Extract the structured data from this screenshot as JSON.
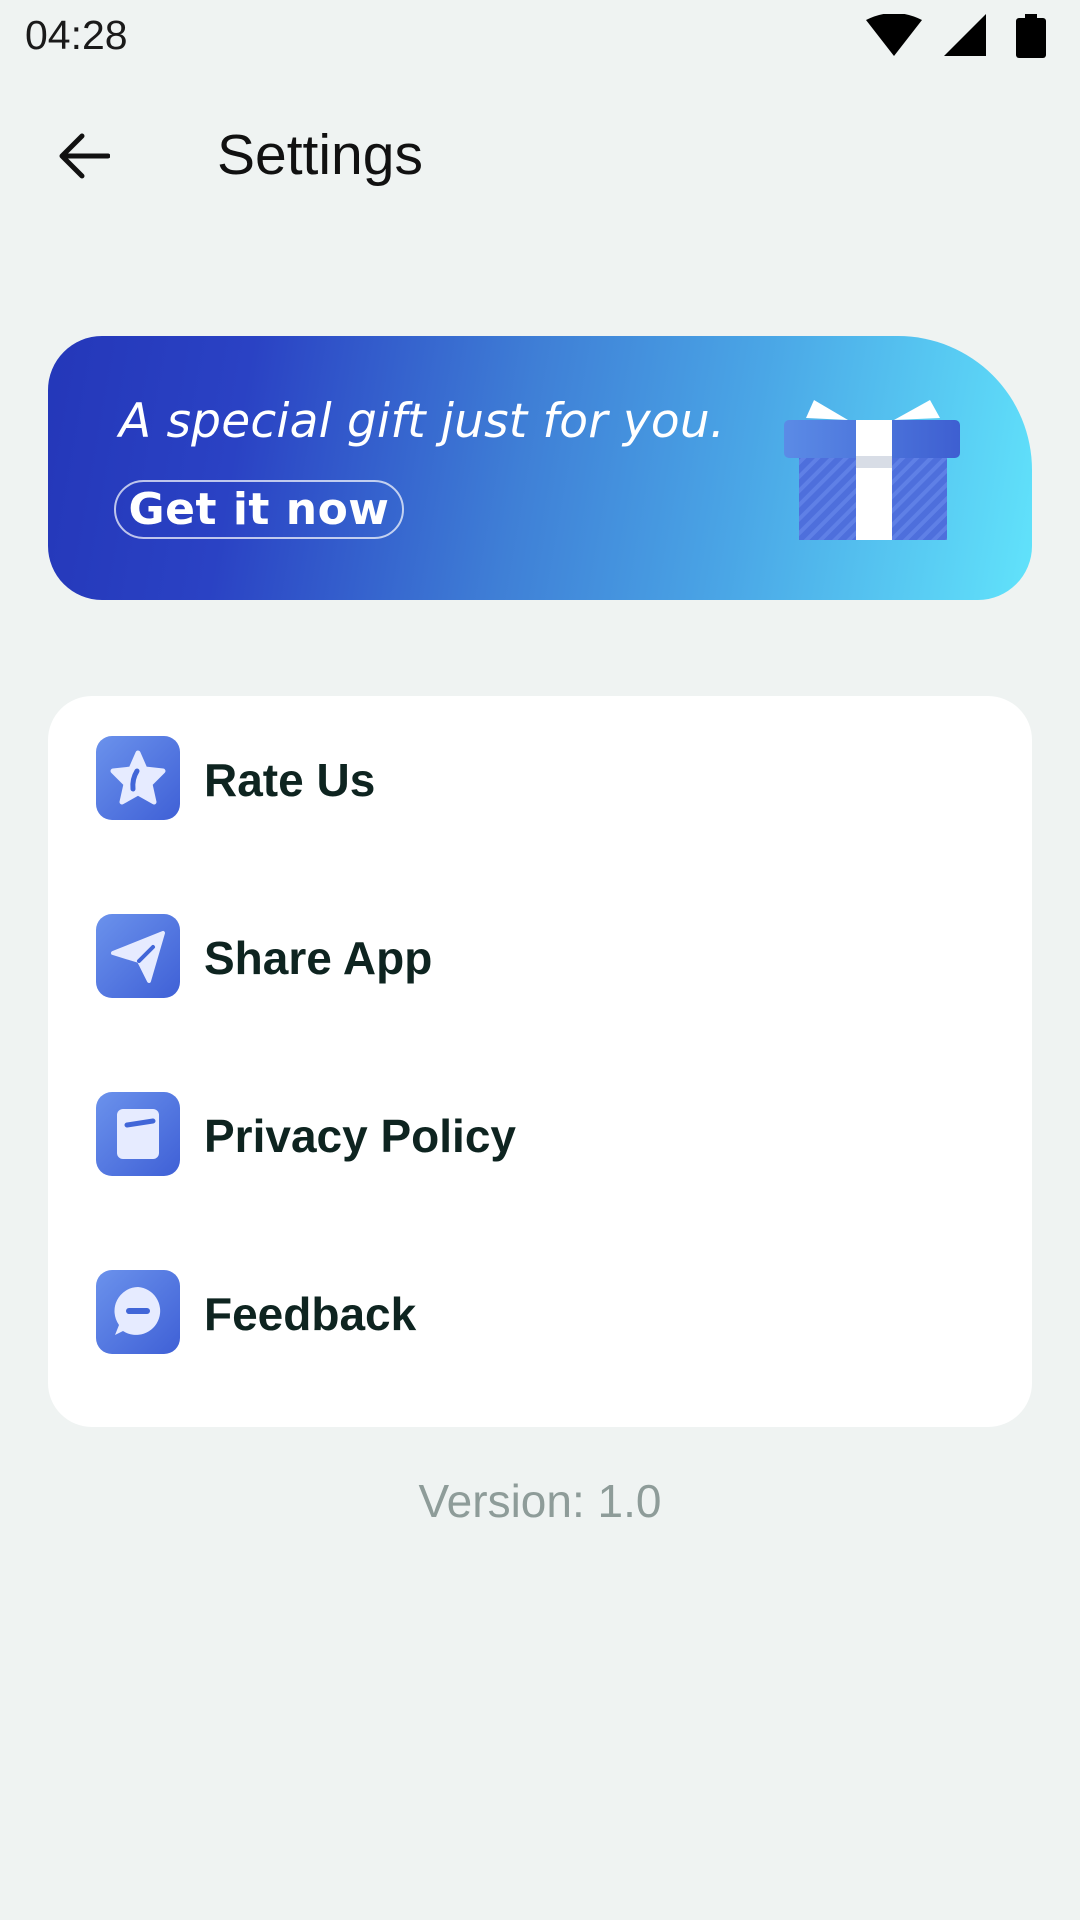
{
  "status_bar": {
    "time": "04:28",
    "icons": [
      "wifi-icon",
      "cell-signal-icon",
      "battery-icon"
    ]
  },
  "app_bar": {
    "title": "Settings",
    "back_icon": "arrow-left-icon"
  },
  "promo": {
    "text": "A special gift just for you.",
    "cta_label": "Get it now",
    "icon": "gift-icon",
    "gradient": [
      "#2437b9",
      "#61e3fb"
    ]
  },
  "menu": {
    "items": [
      {
        "label": "Rate Us",
        "icon": "star-icon"
      },
      {
        "label": "Share App",
        "icon": "paper-plane-icon"
      },
      {
        "label": "Privacy Policy",
        "icon": "document-icon"
      },
      {
        "label": "Feedback",
        "icon": "chat-bubble-icon"
      }
    ]
  },
  "footer": {
    "version": "Version: 1.0"
  },
  "colors": {
    "background": "#eff3f2",
    "accent": "#3f60d6",
    "label_text": "#0e2420",
    "muted_text": "#8e9c99"
  }
}
